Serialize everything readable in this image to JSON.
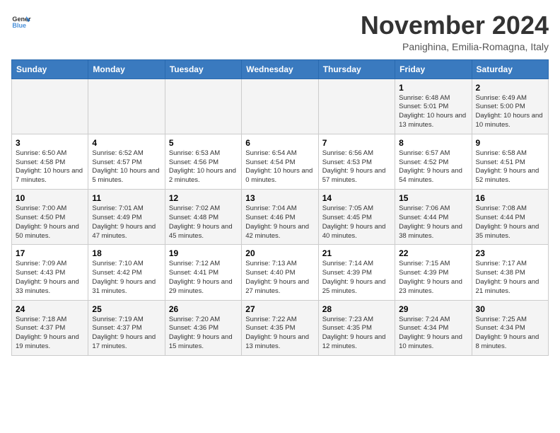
{
  "logo": {
    "text_general": "General",
    "text_blue": "Blue"
  },
  "title": "November 2024",
  "location": "Panighina, Emilia-Romagna, Italy",
  "days_of_week": [
    "Sunday",
    "Monday",
    "Tuesday",
    "Wednesday",
    "Thursday",
    "Friday",
    "Saturday"
  ],
  "weeks": [
    {
      "cells": [
        {
          "day": null
        },
        {
          "day": null
        },
        {
          "day": null
        },
        {
          "day": null
        },
        {
          "day": null
        },
        {
          "day": "1",
          "sunrise": "6:48 AM",
          "sunset": "5:01 PM",
          "daylight": "10 hours and 13 minutes."
        },
        {
          "day": "2",
          "sunrise": "6:49 AM",
          "sunset": "5:00 PM",
          "daylight": "10 hours and 10 minutes."
        }
      ]
    },
    {
      "cells": [
        {
          "day": "3",
          "sunrise": "6:50 AM",
          "sunset": "4:58 PM",
          "daylight": "10 hours and 7 minutes."
        },
        {
          "day": "4",
          "sunrise": "6:52 AM",
          "sunset": "4:57 PM",
          "daylight": "10 hours and 5 minutes."
        },
        {
          "day": "5",
          "sunrise": "6:53 AM",
          "sunset": "4:56 PM",
          "daylight": "10 hours and 2 minutes."
        },
        {
          "day": "6",
          "sunrise": "6:54 AM",
          "sunset": "4:54 PM",
          "daylight": "10 hours and 0 minutes."
        },
        {
          "day": "7",
          "sunrise": "6:56 AM",
          "sunset": "4:53 PM",
          "daylight": "9 hours and 57 minutes."
        },
        {
          "day": "8",
          "sunrise": "6:57 AM",
          "sunset": "4:52 PM",
          "daylight": "9 hours and 54 minutes."
        },
        {
          "day": "9",
          "sunrise": "6:58 AM",
          "sunset": "4:51 PM",
          "daylight": "9 hours and 52 minutes."
        }
      ]
    },
    {
      "cells": [
        {
          "day": "10",
          "sunrise": "7:00 AM",
          "sunset": "4:50 PM",
          "daylight": "9 hours and 50 minutes."
        },
        {
          "day": "11",
          "sunrise": "7:01 AM",
          "sunset": "4:49 PM",
          "daylight": "9 hours and 47 minutes."
        },
        {
          "day": "12",
          "sunrise": "7:02 AM",
          "sunset": "4:48 PM",
          "daylight": "9 hours and 45 minutes."
        },
        {
          "day": "13",
          "sunrise": "7:04 AM",
          "sunset": "4:46 PM",
          "daylight": "9 hours and 42 minutes."
        },
        {
          "day": "14",
          "sunrise": "7:05 AM",
          "sunset": "4:45 PM",
          "daylight": "9 hours and 40 minutes."
        },
        {
          "day": "15",
          "sunrise": "7:06 AM",
          "sunset": "4:44 PM",
          "daylight": "9 hours and 38 minutes."
        },
        {
          "day": "16",
          "sunrise": "7:08 AM",
          "sunset": "4:44 PM",
          "daylight": "9 hours and 35 minutes."
        }
      ]
    },
    {
      "cells": [
        {
          "day": "17",
          "sunrise": "7:09 AM",
          "sunset": "4:43 PM",
          "daylight": "9 hours and 33 minutes."
        },
        {
          "day": "18",
          "sunrise": "7:10 AM",
          "sunset": "4:42 PM",
          "daylight": "9 hours and 31 minutes."
        },
        {
          "day": "19",
          "sunrise": "7:12 AM",
          "sunset": "4:41 PM",
          "daylight": "9 hours and 29 minutes."
        },
        {
          "day": "20",
          "sunrise": "7:13 AM",
          "sunset": "4:40 PM",
          "daylight": "9 hours and 27 minutes."
        },
        {
          "day": "21",
          "sunrise": "7:14 AM",
          "sunset": "4:39 PM",
          "daylight": "9 hours and 25 minutes."
        },
        {
          "day": "22",
          "sunrise": "7:15 AM",
          "sunset": "4:39 PM",
          "daylight": "9 hours and 23 minutes."
        },
        {
          "day": "23",
          "sunrise": "7:17 AM",
          "sunset": "4:38 PM",
          "daylight": "9 hours and 21 minutes."
        }
      ]
    },
    {
      "cells": [
        {
          "day": "24",
          "sunrise": "7:18 AM",
          "sunset": "4:37 PM",
          "daylight": "9 hours and 19 minutes."
        },
        {
          "day": "25",
          "sunrise": "7:19 AM",
          "sunset": "4:37 PM",
          "daylight": "9 hours and 17 minutes."
        },
        {
          "day": "26",
          "sunrise": "7:20 AM",
          "sunset": "4:36 PM",
          "daylight": "9 hours and 15 minutes."
        },
        {
          "day": "27",
          "sunrise": "7:22 AM",
          "sunset": "4:35 PM",
          "daylight": "9 hours and 13 minutes."
        },
        {
          "day": "28",
          "sunrise": "7:23 AM",
          "sunset": "4:35 PM",
          "daylight": "9 hours and 12 minutes."
        },
        {
          "day": "29",
          "sunrise": "7:24 AM",
          "sunset": "4:34 PM",
          "daylight": "9 hours and 10 minutes."
        },
        {
          "day": "30",
          "sunrise": "7:25 AM",
          "sunset": "4:34 PM",
          "daylight": "9 hours and 8 minutes."
        }
      ]
    }
  ]
}
